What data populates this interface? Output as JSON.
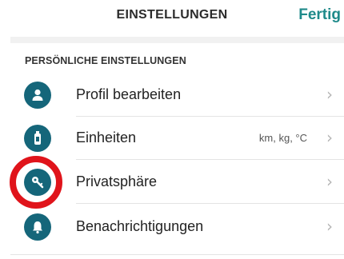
{
  "navbar": {
    "title": "EINSTELLUNGEN",
    "done_label": "Fertig"
  },
  "section": {
    "header": "PERSÖNLICHE EINSTELLUNGEN"
  },
  "items": [
    {
      "label": "Profil bearbeiten",
      "icon": "person-icon",
      "value": ""
    },
    {
      "label": "Einheiten",
      "icon": "bottle-icon",
      "value": "km, kg, °C"
    },
    {
      "label": "Privatsphäre",
      "icon": "key-icon",
      "value": ""
    },
    {
      "label": "Benachrichtigungen",
      "icon": "bell-icon",
      "value": ""
    }
  ],
  "colors": {
    "accent": "#1f8a8a",
    "icon_bg": "#15667a",
    "highlight": "#e0141b"
  }
}
